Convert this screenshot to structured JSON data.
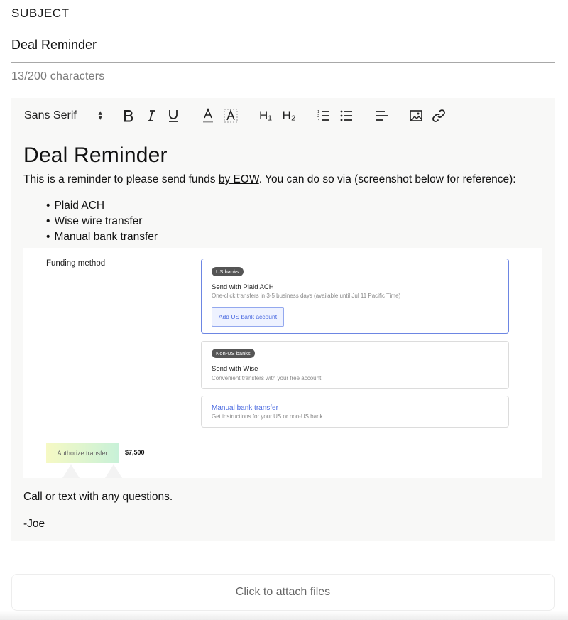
{
  "subject": {
    "label": "SUBJECT",
    "value": "Deal Reminder",
    "char_count": "13/200 characters"
  },
  "toolbar": {
    "font_family": "Sans Serif",
    "heading1": "H₁",
    "heading2": "H₂",
    "icons": [
      "bold-icon",
      "italic-icon",
      "underline-icon",
      "text-color-icon",
      "highlight-icon",
      "ordered-list-icon",
      "bullet-list-icon",
      "align-left-icon",
      "image-icon",
      "link-icon"
    ]
  },
  "body": {
    "title": "Deal Reminder",
    "intro_before": "This is a reminder to please send funds ",
    "intro_underlined": "by EOW",
    "intro_after": ". You can do so via (screenshot below for reference):",
    "bullets": [
      "Plaid ACH",
      "Wise wire transfer",
      "Manual bank transfer"
    ],
    "closing": "Call or text with any questions.",
    "signature": "-Joe"
  },
  "screenshot": {
    "funding_label": "Funding method",
    "option1": {
      "badge": "US banks",
      "title": "Send with Plaid ACH",
      "subtitle": "One-click transfers in 3-5 business days (available until Jul 11 Pacific Time)",
      "button": "Add US bank account"
    },
    "option2": {
      "badge": "Non-US banks",
      "title": "Send with Wise",
      "subtitle": "Convenient transfers with your free account"
    },
    "option3": {
      "title": "Manual bank transfer",
      "subtitle": "Get instructions for your US or non-US bank"
    },
    "authorize_button": "Authorize transfer",
    "amount": "$7,500",
    "colors": {
      "accent": "#4a6ae0",
      "selected_border": "#6d86e3"
    }
  },
  "attach": {
    "label": "Click to attach files"
  }
}
